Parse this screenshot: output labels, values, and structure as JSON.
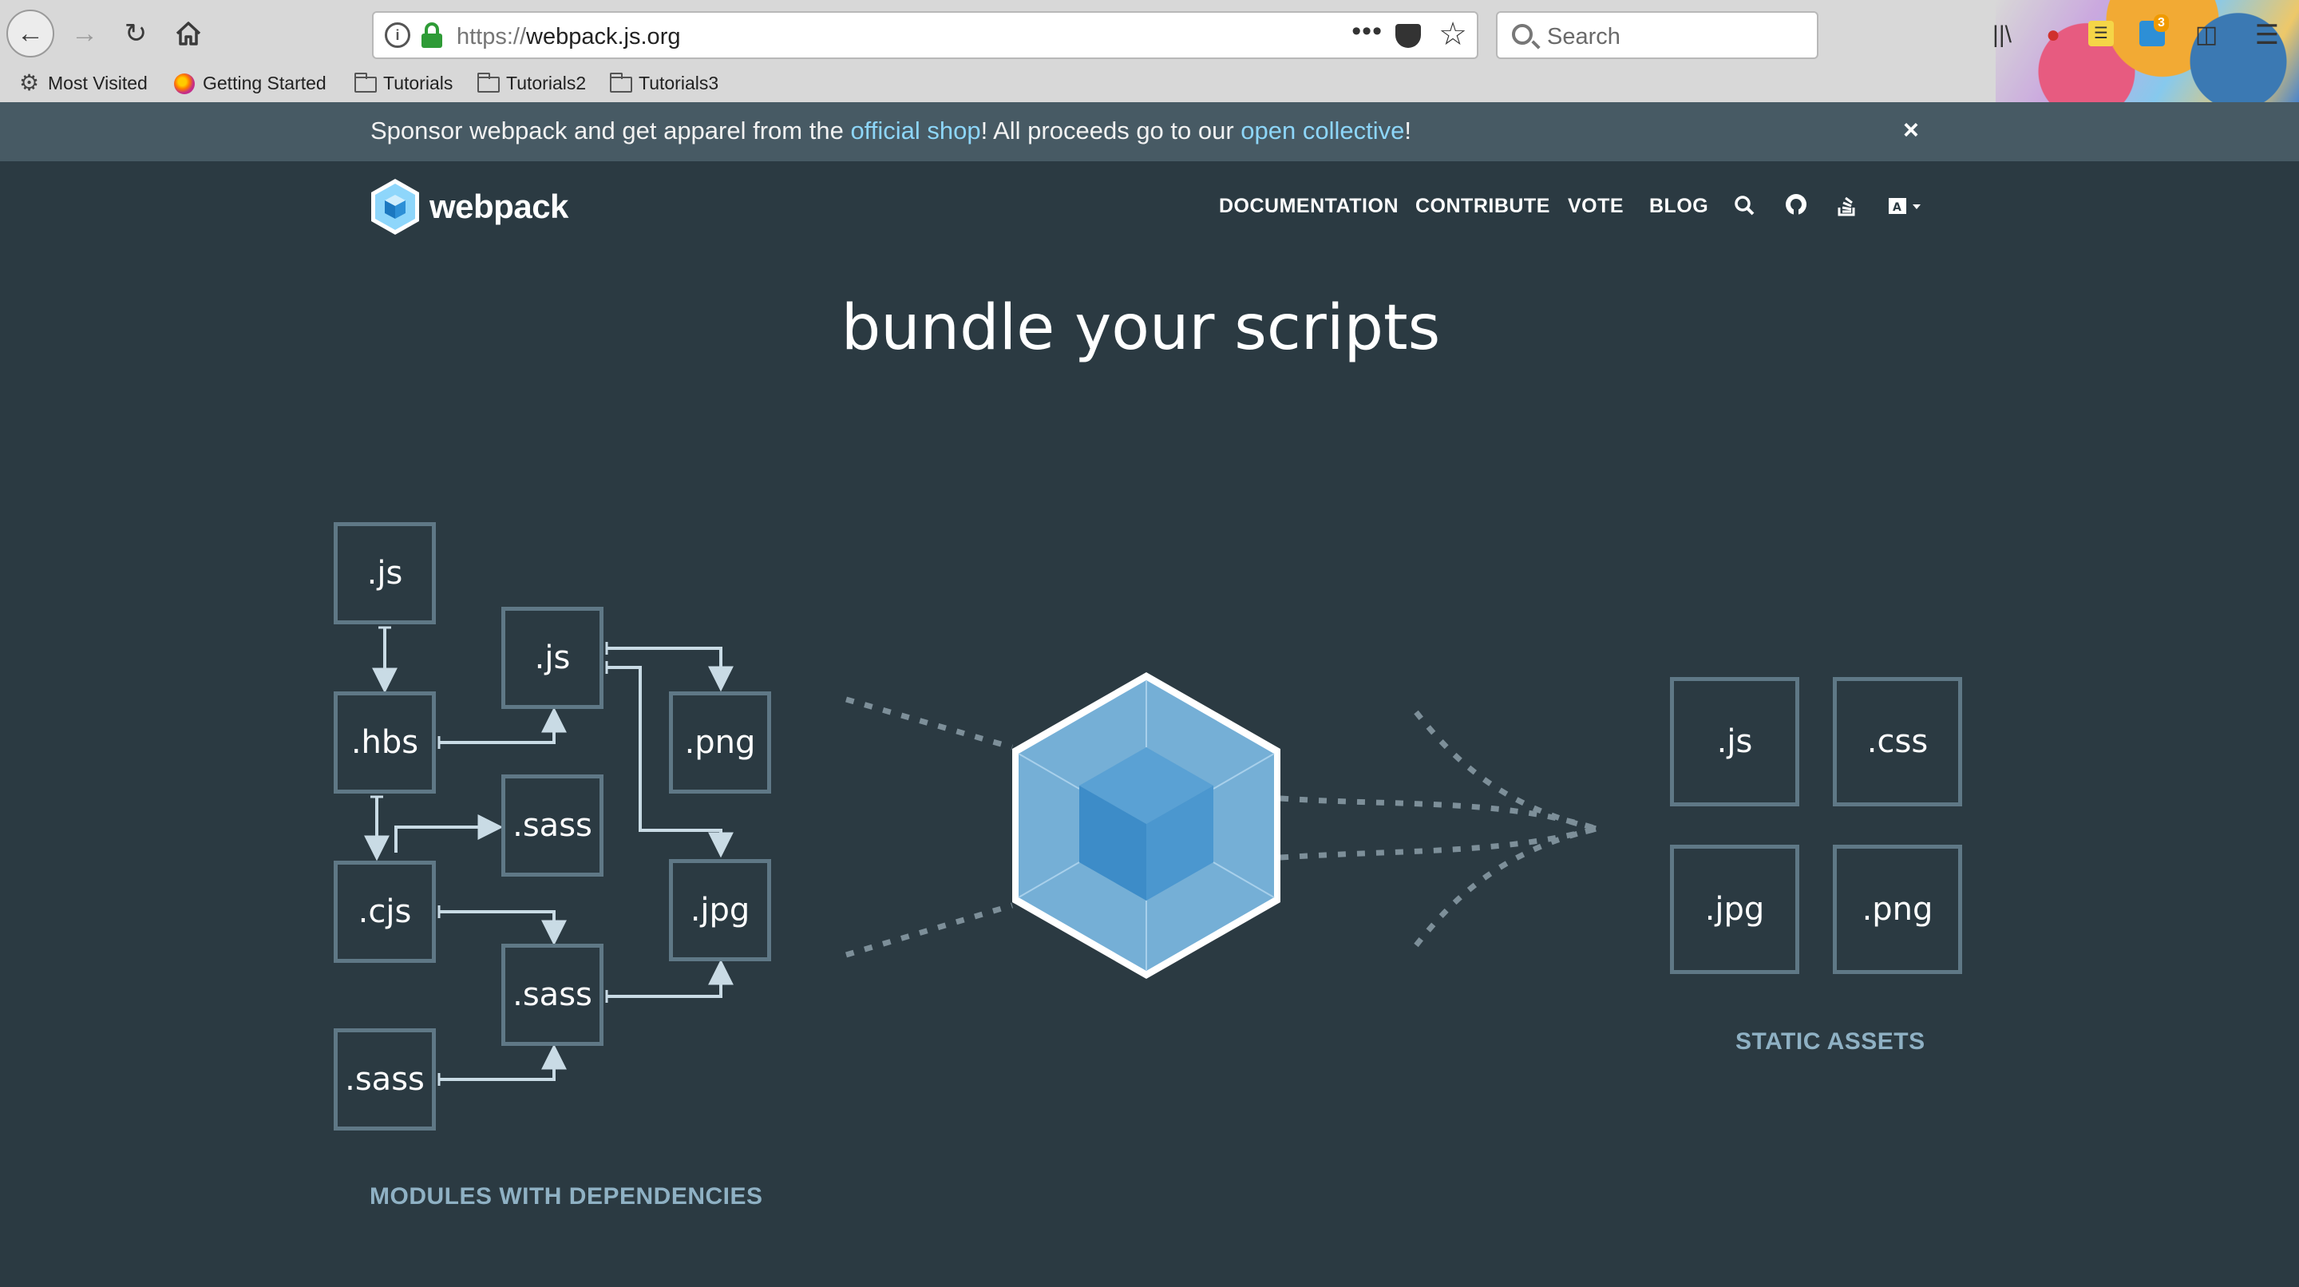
{
  "browser": {
    "url_scheme": "https://",
    "url_host": "webpack.js.org",
    "search_placeholder": "Search",
    "ext_badge_count": "3",
    "bookmarks": [
      {
        "label": "Most Visited",
        "icon": "gear-icon"
      },
      {
        "label": "Getting Started",
        "icon": "firefox-icon"
      },
      {
        "label": "Tutorials",
        "icon": "folder-icon"
      },
      {
        "label": "Tutorials2",
        "icon": "folder-icon"
      },
      {
        "label": "Tutorials3",
        "icon": "folder-icon"
      }
    ]
  },
  "banner": {
    "text_before": "Sponsor webpack and get apparel from the ",
    "link1": "official shop",
    "text_middle": "! All proceeds go to our ",
    "link2": "open collective",
    "text_after": "!",
    "close": "×"
  },
  "site": {
    "logo_text": "webpack",
    "nav": [
      "DOCUMENTATION",
      "CONTRIBUTE",
      "VOTE",
      "BLOG"
    ],
    "nav_icons": [
      "search-icon",
      "github-icon",
      "stackoverflow-icon",
      "language-icon"
    ]
  },
  "hero": {
    "title": "bundle your scripts",
    "modules": [
      ".js",
      ".js",
      ".hbs",
      ".png",
      ".sass",
      ".cjs",
      ".jpg",
      ".sass",
      ".sass"
    ],
    "assets": [
      ".js",
      ".css",
      ".jpg",
      ".png"
    ],
    "modules_caption": "MODULES WITH DEPENDENCIES",
    "assets_caption": "STATIC ASSETS"
  },
  "colors": {
    "background": "#2b3a42",
    "banner": "#475a64",
    "link": "#8dd6f9",
    "box_border": "#5f7886",
    "cube_light": "#8ed6fb",
    "cube_dark": "#1c78c0"
  }
}
